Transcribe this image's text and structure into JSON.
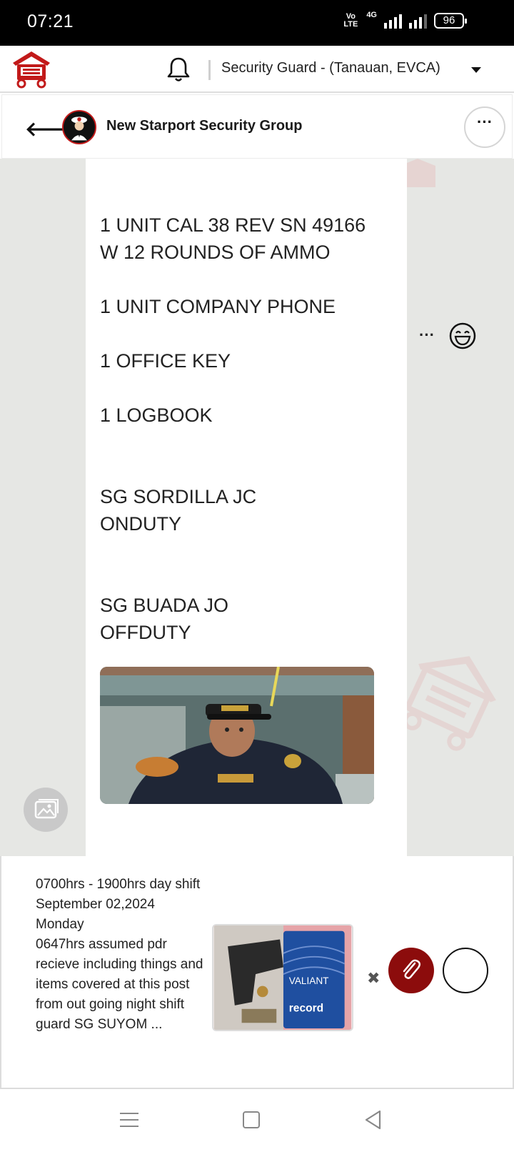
{
  "status_bar": {
    "time": "07:21",
    "volte": "Vo\nLTE",
    "network": "4G",
    "battery": "96"
  },
  "app_header": {
    "role_selector": "Security Guard - (Tanauan, EVCA)"
  },
  "chat_header": {
    "title": "New Starport Security Group"
  },
  "message": {
    "text": "COVERED IN THIS POST\n\n\n1 UNIT CAL 38 REV SN 49166\nW 12 ROUNDS OF AMMO\n\n1 UNIT COMPANY PHONE\n\n1 OFFICE KEY\n\n1 LOGBOOK\n\n\nSG SORDILLA JC\nONDUTY\n\n\nSG BUADA JO\nOFFDUTY",
    "photo": "selfie-security-guard"
  },
  "composer": {
    "draft_text": "0700hrs - 1900hrs day shift\nSeptember 02,2024\nMonday\n0647hrs assumed pdr recieve including things and items covered at this post from out going night shift guard SG SUYOM ..."
  },
  "colors": {
    "brand_red": "#c21a1a",
    "attach_button": "#8c0c0c",
    "chat_background": "#e6e7e4"
  },
  "icons": {
    "back": "arrow-left-icon",
    "bell": "bell-icon",
    "more": "ellipsis-icon",
    "emoji": "emoji-icon",
    "gallery": "image-icon",
    "attach": "paperclip-icon",
    "remove": "close-icon"
  }
}
